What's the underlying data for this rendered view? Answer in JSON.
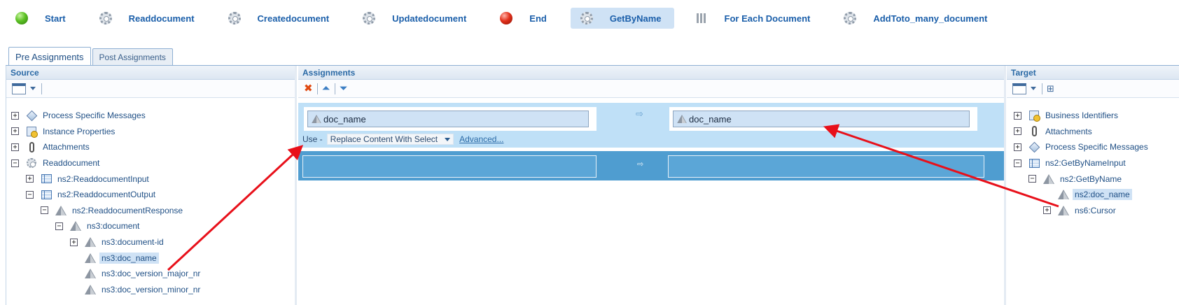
{
  "activities": [
    {
      "label": "Start",
      "icon": "green-ball-icon",
      "selected": false
    },
    {
      "label": "Readdocument",
      "icon": "gear-icon",
      "selected": false
    },
    {
      "label": "Createdocument",
      "icon": "gear-icon",
      "selected": false
    },
    {
      "label": "Updatedocument",
      "icon": "gear-icon",
      "selected": false
    },
    {
      "label": "End",
      "icon": "red-ball-icon",
      "selected": false
    },
    {
      "label": "GetByName",
      "icon": "gear-icon",
      "selected": true
    },
    {
      "label": "For Each Document",
      "icon": "bars-icon",
      "selected": false
    },
    {
      "label": "AddToto_many_document",
      "icon": "gear-icon",
      "selected": false
    }
  ],
  "tabs": {
    "pre": "Pre Assignments",
    "post": "Post Assignments"
  },
  "source": {
    "title": "Source",
    "nodes": [
      {
        "label": "Process Specific Messages",
        "exp": "+",
        "icon": "diamond",
        "indent": 0
      },
      {
        "label": "Instance Properties",
        "exp": "+",
        "icon": "props",
        "indent": 0
      },
      {
        "label": "Attachments",
        "exp": "+",
        "icon": "clip",
        "indent": 0
      },
      {
        "label": "Readdocument",
        "exp": "−",
        "icon": "gear",
        "indent": 0
      },
      {
        "label": "ns2:ReaddocumentInput",
        "exp": "+",
        "icon": "grid",
        "indent": 1
      },
      {
        "label": "ns2:ReaddocumentOutput",
        "exp": "−",
        "icon": "grid",
        "indent": 1
      },
      {
        "label": "ns2:ReaddocumentResponse",
        "exp": "−",
        "icon": "pyr",
        "indent": 2
      },
      {
        "label": "ns3:document",
        "exp": "−",
        "icon": "pyr",
        "indent": 3
      },
      {
        "label": "ns3:document-id",
        "exp": "+",
        "icon": "pyr",
        "indent": 4
      },
      {
        "label": "ns3:doc_name",
        "exp": "",
        "icon": "pyr",
        "indent": 4,
        "highlight": true
      },
      {
        "label": "ns3:doc_version_major_nr",
        "exp": "",
        "icon": "pyr",
        "indent": 4
      },
      {
        "label": "ns3:doc_version_minor_nr",
        "exp": "",
        "icon": "pyr",
        "indent": 4
      }
    ]
  },
  "assignments": {
    "title": "Assignments",
    "row1": {
      "source": "doc_name",
      "target": "doc_name",
      "use_label": "Use -",
      "mode": "Replace Content With Select",
      "advanced": "Advanced..."
    }
  },
  "target": {
    "title": "Target",
    "nodes": [
      {
        "label": "Business Identifiers",
        "exp": "+",
        "icon": "props",
        "indent": 0
      },
      {
        "label": "Attachments",
        "exp": "+",
        "icon": "clip",
        "indent": 0
      },
      {
        "label": "Process Specific Messages",
        "exp": "+",
        "icon": "diamond",
        "indent": 0
      },
      {
        "label": "ns2:GetByNameInput",
        "exp": "−",
        "icon": "grid",
        "indent": 0
      },
      {
        "label": "ns2:GetByName",
        "exp": "−",
        "icon": "pyr",
        "indent": 1
      },
      {
        "label": "ns2:doc_name",
        "exp": "",
        "icon": "pyr",
        "indent": 2,
        "highlight": true
      },
      {
        "label": "ns6:Cursor",
        "exp": "+",
        "icon": "pyr",
        "indent": 2
      }
    ]
  },
  "colors": {
    "annotation_arrow": "#e8101a",
    "selected_row": "#bfe0f7",
    "empty_row": "#4f9dd0"
  }
}
